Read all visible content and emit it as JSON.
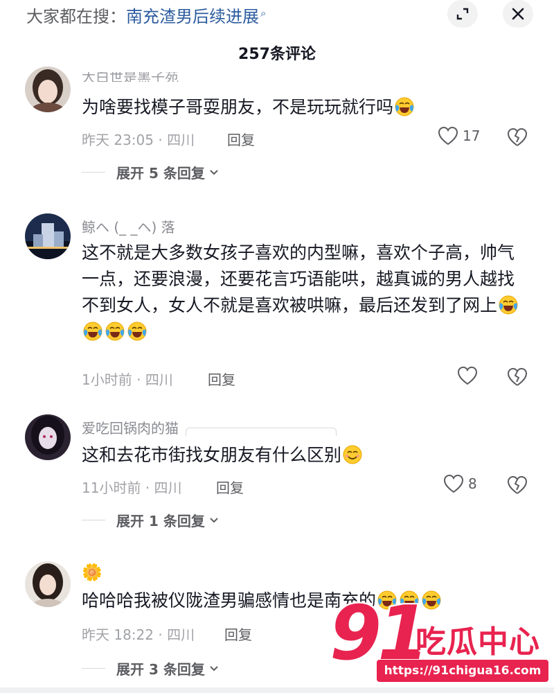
{
  "header": {
    "search_prefix": "大家都在搜：",
    "search_query": "南充渣男后续进展",
    "title": "257条评论"
  },
  "comments": [
    {
      "username": "大白世是黑子苑",
      "text": "为啥要找模子哥耍朋友，不是玩玩就行吗",
      "time": "昨天 23:05",
      "location": "四川",
      "reply_label": "回复",
      "likes": "17",
      "expand": "展开 5 条回复"
    },
    {
      "username": "鲸ヘ (_ _ヘ) 落",
      "text": "这不就是大多数女孩子喜欢的内型嘛，喜欢个子高，帅气一点，还要浪漫，还要花言巧语能哄，越真诚的男人越找不到女人，女人不就是喜欢被哄嘛，最后还发到了网上",
      "time": "1小时前",
      "location": "四川",
      "reply_label": "回复",
      "likes": ""
    },
    {
      "username": "爱吃回锅肉的猫",
      "text": "这和去花市街找女朋友有什么区别",
      "time": "11小时前",
      "location": "四川",
      "reply_label": "回复",
      "likes": "8",
      "expand": "展开 1 条回复"
    },
    {
      "username": "🌼",
      "text": "哈哈哈我被仪陇渣男骗感情也是南充的",
      "time": "昨天 18:22",
      "location": "四川",
      "reply_label": "回复",
      "likes": "",
      "expand": "展开 3 条回复"
    }
  ],
  "watermark": {
    "logo_number": "91",
    "logo_text": "吃瓜中心",
    "url": "https://91chigua16.com"
  },
  "icons": [
    "search-icon",
    "expand-icon",
    "close-icon",
    "heart-icon",
    "broken-heart-icon",
    "chevron-down-icon",
    "laugh-cry-emoji",
    "smile-emoji",
    "flower-emoji"
  ],
  "colors": {
    "link": "#2b5b9e",
    "text": "#161823",
    "muted": "#a1a2a7",
    "watermark": "#e8234f"
  }
}
